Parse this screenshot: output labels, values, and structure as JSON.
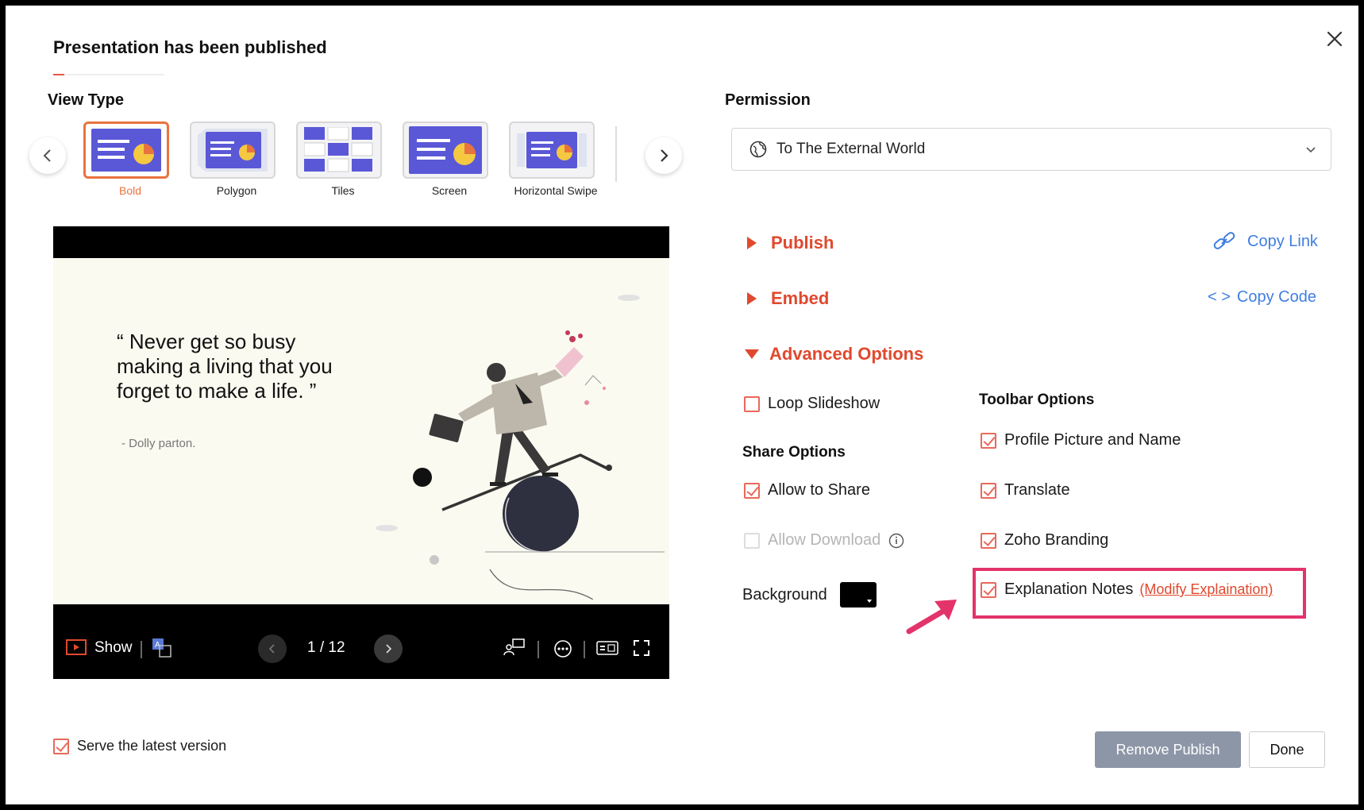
{
  "dialog": {
    "title": "Presentation has been published",
    "close_icon": "close-icon"
  },
  "view_type": {
    "label": "View Type",
    "options": [
      {
        "label": "Bold",
        "selected": true
      },
      {
        "label": "Polygon",
        "selected": false
      },
      {
        "label": "Tiles",
        "selected": false
      },
      {
        "label": "Screen",
        "selected": false
      },
      {
        "label": "Horizontal Swipe",
        "selected": false
      }
    ]
  },
  "preview": {
    "quote": "“ Never get so busy making a living that you forget to make a life. ”",
    "author": "-  Dolly parton.",
    "toolbar": {
      "show_label": "Show",
      "page_indicator": "1 / 12"
    }
  },
  "permission": {
    "label": "Permission",
    "selected": "To The External World"
  },
  "sections": {
    "publish": {
      "label": "Publish",
      "action": "Copy Link"
    },
    "embed": {
      "label": "Embed",
      "action": "Copy Code",
      "action_prefix": "< >"
    },
    "advanced": {
      "label": "Advanced Options"
    }
  },
  "advanced_options": {
    "loop_slideshow": {
      "label": "Loop Slideshow",
      "checked": false
    },
    "share_options": {
      "label": "Share Options",
      "allow_share": {
        "label": "Allow to Share",
        "checked": true
      },
      "allow_download": {
        "label": "Allow Download",
        "checked": false,
        "disabled": true
      }
    },
    "background": {
      "label": "Background",
      "color": "#000000"
    },
    "toolbar_options": {
      "label": "Toolbar Options",
      "profile": {
        "label": "Profile Picture and Name",
        "checked": true
      },
      "translate": {
        "label": "Translate",
        "checked": true
      },
      "branding": {
        "label": "Zoho Branding",
        "checked": true
      },
      "explanation_notes": {
        "label": "Explanation Notes",
        "checked": true,
        "link": "(Modify Explaination)"
      }
    }
  },
  "footer": {
    "serve_latest": {
      "label": "Serve the latest version",
      "checked": true
    },
    "remove_publish": "Remove Publish",
    "done": "Done"
  },
  "colors": {
    "accent_red": "#e0492e",
    "link_blue": "#3f7ee0",
    "highlight": "#e3336a",
    "selected_orange": "#e9733e",
    "thumb_purple": "#5a58d6"
  }
}
